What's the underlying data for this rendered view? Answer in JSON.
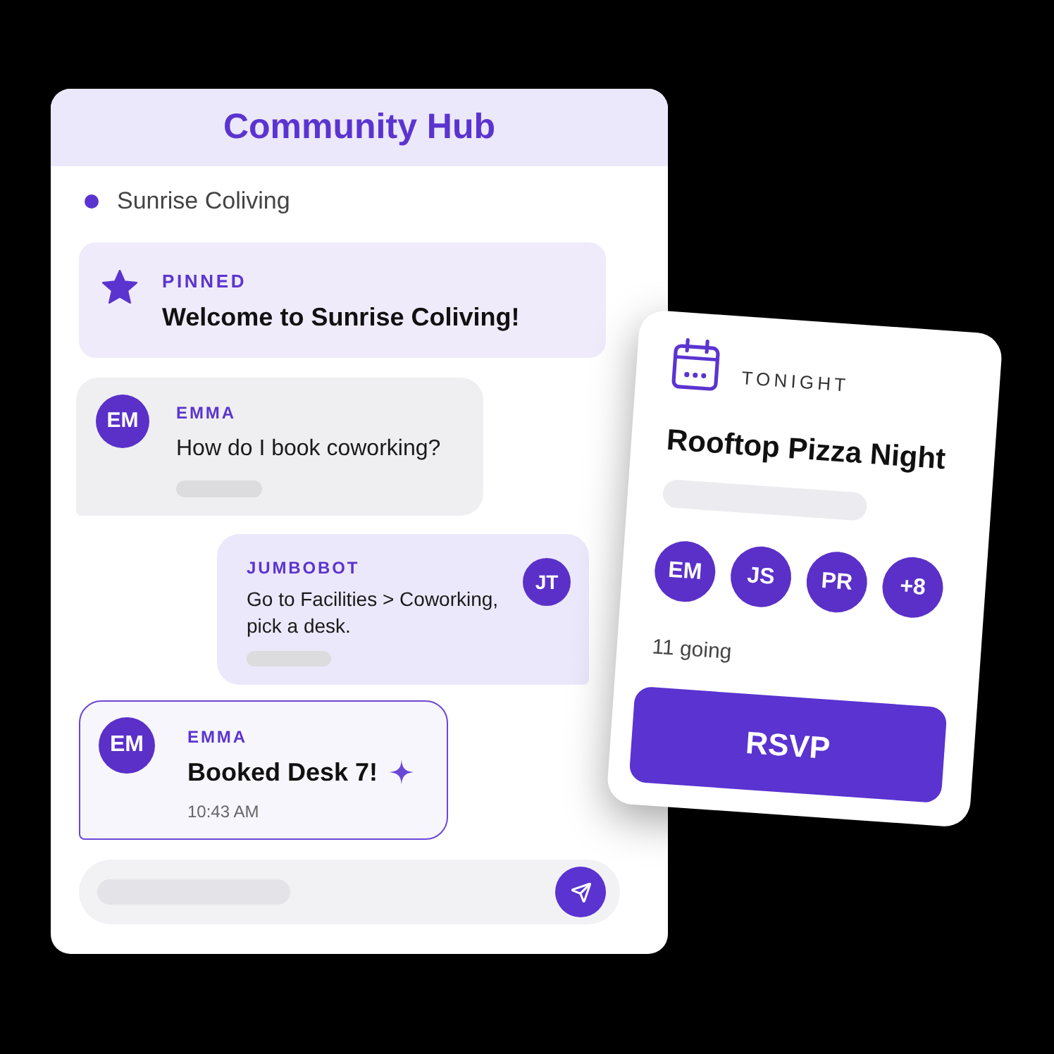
{
  "header": {
    "title": "Community Hub"
  },
  "channel": {
    "name": "Sunrise Coliving"
  },
  "pinned": {
    "label": "PINNED",
    "text": "Welcome to Sunrise Coliving!"
  },
  "messages": [
    {
      "kind": "incoming",
      "initials": "EM",
      "sender": "EMMA",
      "text": "How do I book coworking?"
    },
    {
      "kind": "outgoing",
      "initials": "JT",
      "sender": "JUMBOBOT",
      "text": "Go to Facilities > Coworking, pick a desk."
    },
    {
      "kind": "highlight",
      "initials": "EM",
      "sender": "EMMA",
      "text": "Booked Desk 7!",
      "time": "10:43 AM"
    }
  ],
  "event": {
    "label": "TONIGHT",
    "title": "Rooftop Pizza Night",
    "attendees": [
      "EM",
      "JS",
      "PR",
      "+8"
    ],
    "going": "11 going",
    "button": "RSVP"
  }
}
